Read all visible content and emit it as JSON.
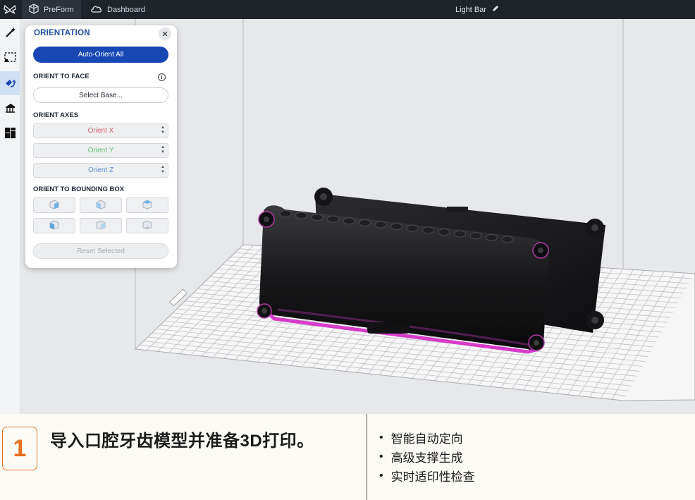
{
  "topbar": {
    "logo_icon": "butterfly-logo-icon",
    "tabs": [
      {
        "label": "PreForm",
        "icon": "cube-icon",
        "active": true
      },
      {
        "label": "Dashboard",
        "icon": "cloud-icon",
        "active": false
      }
    ],
    "job_title": "Light Bar",
    "edit_icon": "pencil-icon"
  },
  "toolbar": {
    "tools": [
      {
        "icon": "magic-wand-icon",
        "active": false
      },
      {
        "icon": "selection-box-icon",
        "active": false
      },
      {
        "icon": "orientation-icon",
        "active": true
      },
      {
        "icon": "supports-icon",
        "active": false
      },
      {
        "icon": "layout-icon",
        "active": false
      }
    ]
  },
  "panel": {
    "title": "ORIENTATION",
    "close_label": "✕",
    "auto_orient_label": "Auto-Orient All",
    "orient_to_face": {
      "label": "ORIENT TO FACE",
      "select_base_label": "Select Base..."
    },
    "orient_axes": {
      "label": "ORIENT AXES",
      "x_label": "Orient X",
      "y_label": "Orient Y",
      "z_label": "Orient Z",
      "x_color": "#d9606a",
      "y_color": "#5cbf6e",
      "z_color": "#5b8fd9"
    },
    "orient_bbox": {
      "label": "ORIENT TO BOUNDING BOX"
    },
    "reset_label": "Reset Selected"
  },
  "caption": {
    "step_number": "1",
    "title": "导入口腔牙齿模型并准备3D打印。",
    "bullets": [
      "智能自动定向",
      "高级支撑生成",
      "实时适印性检查"
    ],
    "accent_color": "#e8701f"
  }
}
